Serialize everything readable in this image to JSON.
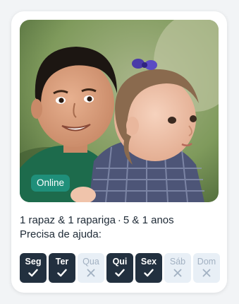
{
  "card": {
    "status": "Online",
    "description": {
      "children": "1 rapaz & 1 rapariga",
      "ages": "5 & 1 anos",
      "separator": "·",
      "help_label": "Precisa de ajuda:"
    }
  },
  "days": [
    {
      "label": "Seg",
      "available": true
    },
    {
      "label": "Ter",
      "available": true
    },
    {
      "label": "Qua",
      "available": false
    },
    {
      "label": "Qui",
      "available": true
    },
    {
      "label": "Sex",
      "available": true
    },
    {
      "label": "Sáb",
      "available": false
    },
    {
      "label": "Dom",
      "available": false
    }
  ],
  "colors": {
    "status_badge": "#1f8f7a",
    "day_selected": "#22303f",
    "day_unselected": "#e8eff6",
    "text": "#1e2a36"
  },
  "icons": {
    "check": "check-icon",
    "cross": "cross-icon"
  }
}
